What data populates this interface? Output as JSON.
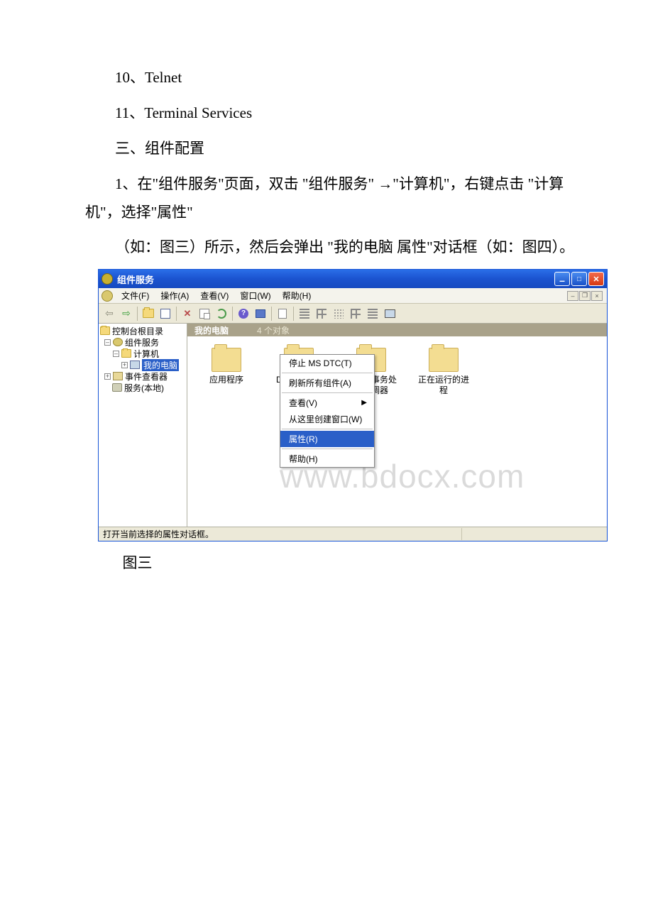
{
  "body": {
    "line1": "10、Telnet",
    "line2": "11、Terminal Services",
    "heading": "三、组件配置",
    "step1": "1、在\"组件服务\"页面，双击 \"组件服务\" →\"计算机\"，右键点击 \"计算机\"，选择\"属性\"",
    "step1_cont": "（如：图三）所示，然后会弹出 \"我的电脑 属性\"对话框（如：图四）。",
    "caption": "图三"
  },
  "window": {
    "title": "组件服务",
    "menubar": {
      "file": "文件(F)",
      "action": "操作(A)",
      "view": "查看(V)",
      "window": "窗口(W)",
      "help": "帮助(H)"
    },
    "tree": {
      "root": "控制台根目录",
      "svc": "组件服务",
      "computers": "计算机",
      "mycomputer": "我的电脑",
      "eventviewer": "事件查看器",
      "localsvc": "服务(本地)"
    },
    "detail": {
      "header_name": "我的电脑",
      "header_count": "4 个对象",
      "items": [
        "应用程序",
        "DCOM 配置",
        "分布式事务处理协调器",
        "正在运行的进程"
      ]
    },
    "context_menu": {
      "stop_dtc": "停止 MS DTC(T)",
      "refresh": "刷新所有组件(A)",
      "view": "查看(V)",
      "new_window": "从这里创建窗口(W)",
      "properties": "属性(R)",
      "help": "帮助(H)"
    },
    "statusbar": "打开当前选择的属性对话框。",
    "watermark": "www.bdocx.com"
  }
}
